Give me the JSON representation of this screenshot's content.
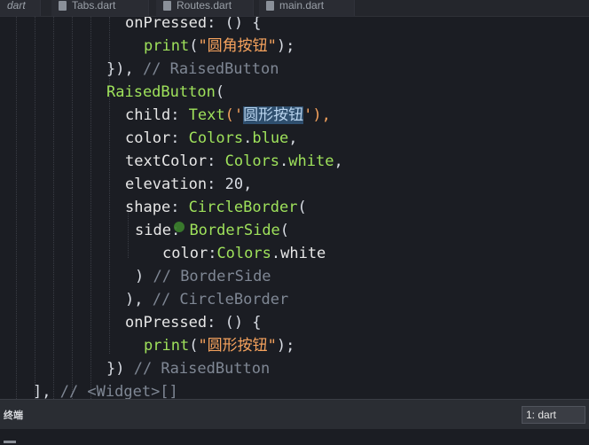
{
  "tabs": [
    {
      "label": "dart"
    },
    {
      "label": "Tabs.dart"
    },
    {
      "label": "Routes.dart"
    },
    {
      "label": "main.dart"
    }
  ],
  "code": {
    "l01": {
      "t1": "onPressed",
      "t2": ": () {"
    },
    "l02": {
      "t1": "print",
      "t2": "(",
      "t3": "\"圆角按钮\"",
      "t4": ");"
    },
    "l03": {
      "t1": "}), ",
      "t2": "// RaisedButton"
    },
    "l04": {
      "t1": "RaisedButton",
      "t2": "("
    },
    "l05": {
      "t1": "child",
      "t2": ": ",
      "t3": "Text",
      "t4": "('",
      "t5": "圆形按钮",
      "t6": "'),"
    },
    "l06": {
      "t1": "color",
      "t2": ": ",
      "t3": "Colors",
      "t4": ".",
      "t5": "blue",
      "t6": ","
    },
    "l07": {
      "t1": "textColor",
      "t2": ": ",
      "t3": "Colors",
      "t4": ".",
      "t5": "white",
      "t6": ","
    },
    "l08": {
      "t1": "elevation",
      "t2": ": 20,"
    },
    "l09": {
      "t1": "shape",
      "t2": ": ",
      "t3": "CircleBorder",
      "t4": "("
    },
    "l10": {
      "t1": "side",
      "t2": ": ",
      "t3": "BorderSide",
      "t4": "("
    },
    "l11": {
      "t1": "color",
      "t2": ":",
      "t3": "Colors",
      "t4": ".",
      "t5": "white"
    },
    "l12": {
      "t1": ") ",
      "t2": "// BorderSide"
    },
    "l13": {
      "t1": "), ",
      "t2": "// CircleBorder"
    },
    "l14": {
      "t1": "onPressed",
      "t2": ": () {"
    },
    "l15": {
      "t1": "print",
      "t2": "(",
      "t3": "\"圆形按钮\"",
      "t4": ");"
    },
    "l16": {
      "t1": "}) ",
      "t2": "// RaisedButton"
    },
    "l17": {
      "t1": "], ",
      "t2": "// <Widget>[]"
    }
  },
  "panel": {
    "title": "终端",
    "terminal_select": "1: dart"
  },
  "colors": {
    "background": "#1b1d23",
    "function": "#9fe25b",
    "string": "#f5a25d",
    "comment": "#7f8794",
    "selection": "#2f4f6e"
  }
}
